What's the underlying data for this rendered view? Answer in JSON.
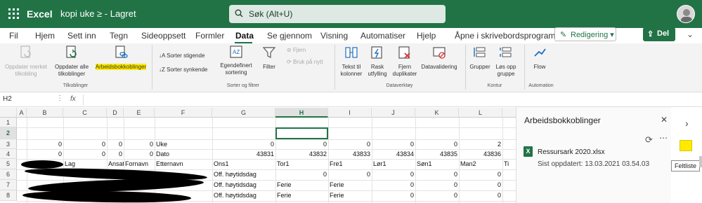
{
  "titlebar": {
    "app_name": "Excel",
    "doc_name": "kopi uke ≥ - Lagret",
    "search_placeholder": "Søk (Alt+U)",
    "colors": {
      "brand": "#217346",
      "highlight": "#ffea00"
    }
  },
  "tabs": [
    {
      "label": "Fil"
    },
    {
      "label": "Hjem"
    },
    {
      "label": "Sett inn"
    },
    {
      "label": "Tegn"
    },
    {
      "label": "Sideoppsett"
    },
    {
      "label": "Formler"
    },
    {
      "label": "Data",
      "active": true
    },
    {
      "label": "Se gjennom"
    },
    {
      "label": "Visning"
    },
    {
      "label": "Automatiser"
    },
    {
      "label": "Hjelp"
    },
    {
      "label": "Åpne i skrivebordsprogram"
    }
  ],
  "toolbar": {
    "edit_label": "Redigering",
    "share_label": "Del",
    "more_label": "›"
  },
  "ribbon": {
    "oppdater_merket": "Oppdater merket tilkobling",
    "oppdater_alle": "Oppdater alle tilkoblinger",
    "arbeidsbok": "Arbeidsbokkoblinger",
    "group_tilkoblinger": "Tilkoblinger",
    "sort_asc": "Sorter stigende",
    "sort_desc": "Sorter synkende",
    "egendefinert": "Egendefinert sortering",
    "filter": "Filter",
    "fjern": "Fjern",
    "bruk_pa_nytt": "Bruk på nytt",
    "group_sorter": "Sorter og filtrer",
    "tekst_til_kolonner": "Tekst til kolonner",
    "rask_utfylling": "Rask utfylling",
    "fjern_duplikater": "Fjern duplikater",
    "datavalidering": "Datavalidering",
    "group_dataverktoy": "Dataverktøy",
    "grupper": "Grupper",
    "los_opp_gruppe": "Løs opp gruppe",
    "group_kontur": "Kontur",
    "flow": "Flow",
    "group_automation": "Automation"
  },
  "formula_bar": {
    "name_box": "H2",
    "fx": "fx"
  },
  "grid": {
    "columns": [
      "A",
      "B",
      "C",
      "D",
      "E",
      "F",
      "G",
      "H",
      "I",
      "J",
      "K",
      "L"
    ],
    "selected_column": "H",
    "rows": [
      "1",
      "2",
      "3",
      "4",
      "5",
      "6",
      "7",
      "8"
    ],
    "selected_row": "2",
    "row3": {
      "B": "0",
      "C": "0",
      "D": "0",
      "E": "0",
      "F": "Uke",
      "G": "0",
      "H": "0",
      "I": "0",
      "J": "0",
      "K": "0",
      "L": "2"
    },
    "row4": {
      "B": "0",
      "C": "0",
      "D": "0",
      "E": "0",
      "F": "Dato",
      "G": "43831",
      "H": "43832",
      "I": "43833",
      "J": "43834",
      "K": "43835",
      "L": "43836"
    },
    "row5": {
      "C": "Lag",
      "D": "Ansat",
      "E": "Fornavn",
      "F": "Etternavn",
      "G": "Ons1",
      "H": "Tor1",
      "I": "Fre1",
      "J": "Lør1",
      "K": "Søn1",
      "L": "Man2",
      "M": "Ti"
    },
    "row6": {
      "G": "Off. høytidsdag",
      "H": "0",
      "I": "0",
      "J": "0",
      "K": "0",
      "L": "0"
    },
    "row7": {
      "G": "Off. høytidsdag",
      "H": "Ferie",
      "I": "Ferie",
      "J": "0",
      "K": "0",
      "L": "0"
    },
    "row8": {
      "G": "Off. høytidsdag",
      "H": "Ferie",
      "I": "Ferie",
      "J": "0",
      "K": "0",
      "L": "0"
    }
  },
  "panel": {
    "title": "Arbeidsbokkoblinger",
    "close": "✕",
    "more": "⋯",
    "file_name": "Ressursark 2020.xlsx",
    "updated": "Sist oppdatert: 13.03.2021 03.54.03"
  },
  "right_rail": {
    "field_list_tooltip": "Feltliste"
  }
}
